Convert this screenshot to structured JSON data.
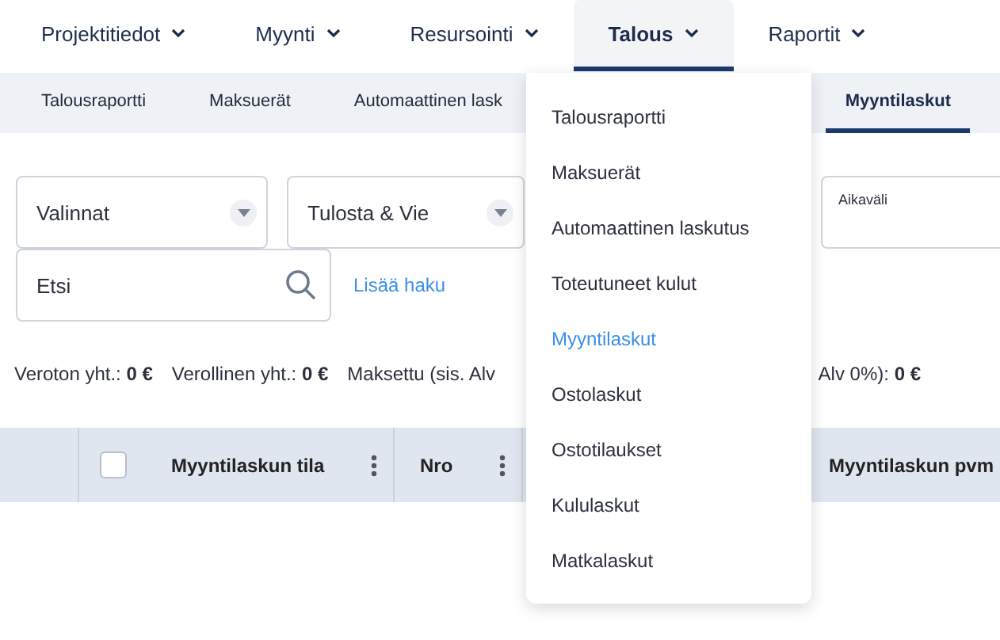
{
  "nav": [
    {
      "label": "Projektitiedot",
      "selected": false
    },
    {
      "label": "Myynti",
      "selected": false
    },
    {
      "label": "Resursointi",
      "selected": false
    },
    {
      "label": "Talous",
      "selected": true
    },
    {
      "label": "Raportit",
      "selected": false
    }
  ],
  "subnav": [
    {
      "label": "Talousraportti",
      "selected": false
    },
    {
      "label": "Maksuerät",
      "selected": false
    },
    {
      "label": "Automaattinen lask",
      "selected": false
    },
    {
      "label": "Myyntilaskut",
      "selected": true
    }
  ],
  "filters": {
    "selects": [
      {
        "label": "Valinnat"
      },
      {
        "label": "Tulosta & Vie"
      }
    ],
    "date_field": {
      "label": "Aikaväli"
    },
    "search": {
      "placeholder": "Etsi"
    },
    "add_search_link": "Lisää haku"
  },
  "summary": [
    "Veroton yht.: **0 €**",
    "Verollinen yht.: **0 €**",
    "Maksettu (sis. Alv",
    "Alv 0%): **0 €**"
  ],
  "table": {
    "select_all": {
      "checked": false
    },
    "columns": [
      {
        "kind": "blank"
      },
      {
        "kind": "check",
        "label": "Myyntilaskun tila",
        "menu": true
      },
      {
        "kind": "text",
        "label": "Nro",
        "menu": true
      },
      {
        "kind": "text",
        "label": "Myyntilaskun pvm",
        "menu": false
      }
    ]
  },
  "menu": {
    "items": [
      {
        "label": "Talousraportti",
        "selected": false
      },
      {
        "label": "Maksuerät",
        "selected": false
      },
      {
        "label": "Automaattinen laskutus",
        "selected": false
      },
      {
        "label": "Toteutuneet kulut",
        "selected": false
      },
      {
        "label": "Myyntilaskut",
        "selected": true
      },
      {
        "label": "Ostolaskut",
        "selected": false
      },
      {
        "label": "Ostotilaukset",
        "selected": false
      },
      {
        "label": "Kululaskut",
        "selected": false
      },
      {
        "label": "Matkalaskut",
        "selected": false
      }
    ]
  }
}
